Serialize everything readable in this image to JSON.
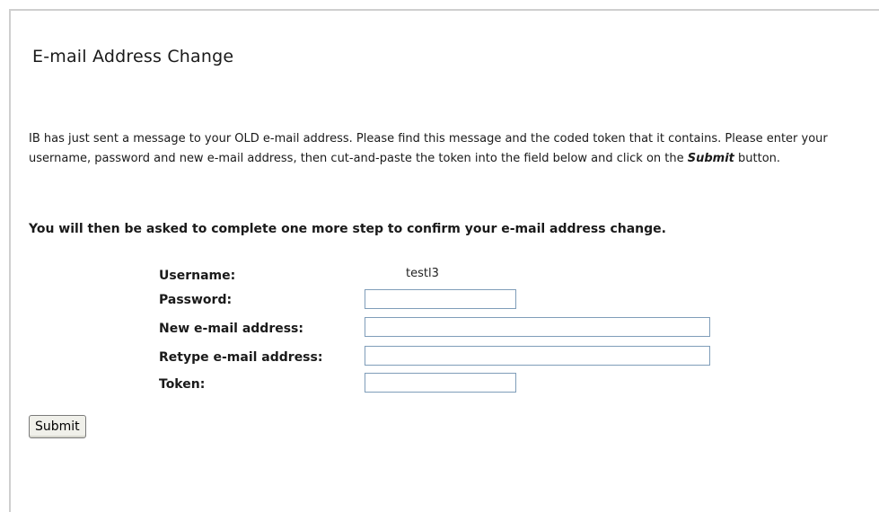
{
  "page": {
    "title": "E-mail Address Change"
  },
  "intro": {
    "part1": "IB has just sent a message to your OLD e-mail address. Please find this message and the coded token that it contains. Please enter your username, password and new e-mail address, then cut-and-paste the token into the field below and click on the ",
    "emphasis": "Submit",
    "part2": " button."
  },
  "notice": "You will then be asked to complete one more step to confirm your e-mail address change.",
  "form": {
    "username_label": "Username:",
    "username_value": "testl3",
    "password_label": "Password:",
    "password_value": "",
    "new_email_label": "New e-mail address:",
    "new_email_value": "",
    "retype_email_label": "Retype e-mail address:",
    "retype_email_value": "",
    "token_label": "Token:",
    "token_value": "",
    "submit_label": "Submit"
  }
}
